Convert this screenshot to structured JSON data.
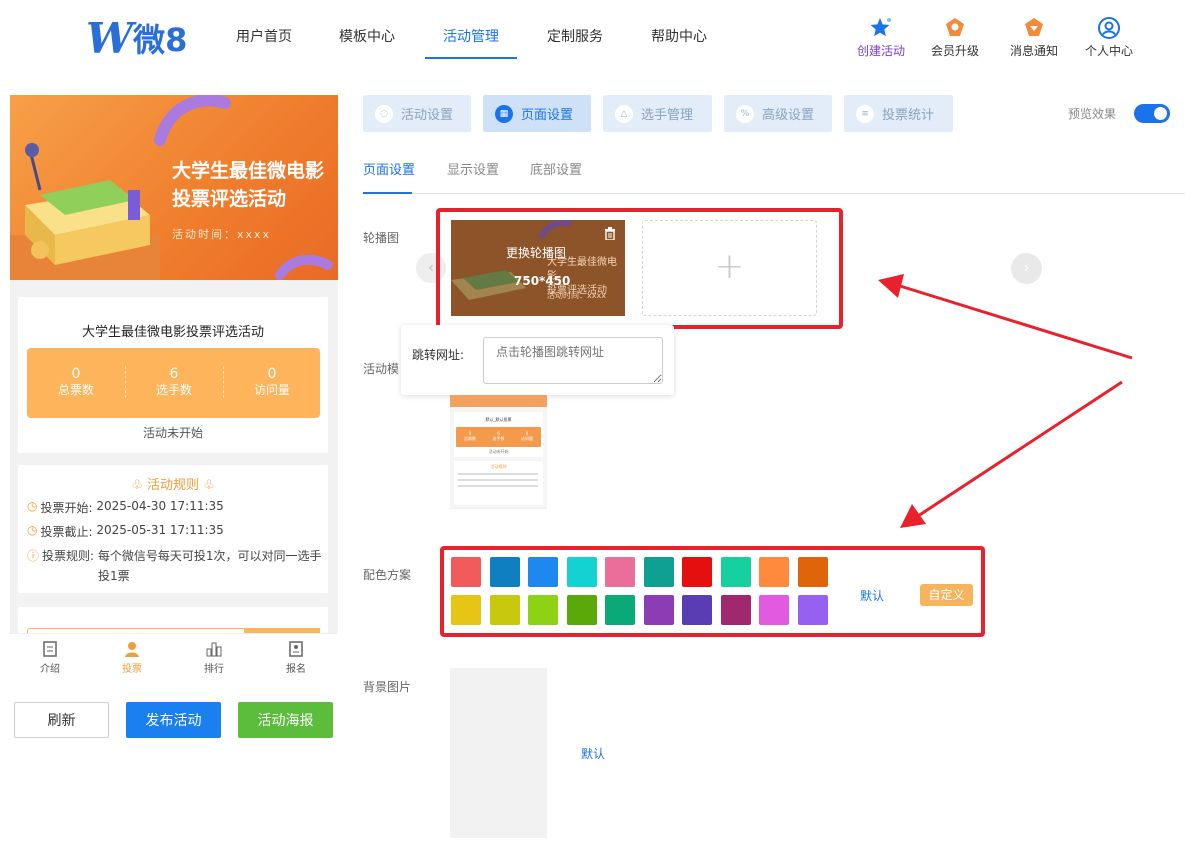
{
  "header": {
    "logo_w": "W",
    "logo_text": "微8",
    "nav": [
      "用户首页",
      "模板中心",
      "活动管理",
      "定制服务",
      "帮助中心"
    ],
    "actions": [
      {
        "label": "创建活动",
        "icon": "star-icon"
      },
      {
        "label": "会员升级",
        "icon": "crown-icon"
      },
      {
        "label": "消息通知",
        "icon": "bell-icon"
      },
      {
        "label": "个人中心",
        "icon": "user-icon"
      }
    ]
  },
  "preview": {
    "banner_title_1": "大学生最佳微电影",
    "banner_title_2": "投票评选活动",
    "banner_time": "活动时间：xxxx",
    "activity_title": "大学生最佳微电影投票评选活动",
    "stats": [
      {
        "num": "0",
        "label": "总票数"
      },
      {
        "num": "6",
        "label": "选手数"
      },
      {
        "num": "0",
        "label": "访问量"
      }
    ],
    "status": "活动未开始",
    "rules_title": "活动规则",
    "rules": [
      {
        "label": "投票开始:",
        "value": "2025-04-30 17:11:35"
      },
      {
        "label": "投票截止:",
        "value": "2025-05-31 17:11:35"
      },
      {
        "label": "投票规则:",
        "value": "每个微信号每天可投1次，可以对同一选手",
        "value2": "投1票"
      }
    ],
    "tabs": [
      "介绍",
      "投票",
      "排行",
      "报名"
    ],
    "buttons": {
      "refresh": "刷新",
      "publish": "发布活动",
      "poster": "活动海报"
    }
  },
  "settings": {
    "top_tabs": [
      "活动设置",
      "页面设置",
      "选手管理",
      "高级设置",
      "投票统计"
    ],
    "preview_label": "预览效果",
    "sub_tabs": [
      "页面设置",
      "显示设置",
      "底部设置"
    ],
    "carousel_label": "轮播图",
    "carousel_overlay": "更换轮播图",
    "carousel_size": "750*450",
    "carousel_thumb_title_1": "大学生最佳微电影",
    "carousel_thumb_title_2": "投票评选活动",
    "carousel_thumb_time": "活动时间：xxxx",
    "add_symbol": "+",
    "link_label": "跳转网址:",
    "link_placeholder": "点击轮播图跳转网址",
    "template_label": "活动模",
    "color_label": "配色方案",
    "color_default": "默认",
    "color_custom": "自定义",
    "bg_label": "背景图片",
    "bg_default": "默认",
    "mini": {
      "title": "默认_默认投票",
      "stats": [
        "0",
        "6",
        "0"
      ],
      "stat_labels": [
        "总票数",
        "选手数",
        "访问量"
      ],
      "status": "活动未开始",
      "rules_title": "活动规则"
    }
  },
  "colors": {
    "row1": [
      "#f25b5b",
      "#0f7fc2",
      "#1e88f0",
      "#14d2d2",
      "#eb6e9a",
      "#0fa092",
      "#e60f0f",
      "#16d0a0",
      "#ff8a3d",
      "#e0650a"
    ],
    "row2": [
      "#e6c514",
      "#c8c80c",
      "#8dd214",
      "#5aa80a",
      "#0aaa78",
      "#8c3cb4",
      "#5a3cb4",
      "#a0286e",
      "#e25ae0",
      "#9660f0"
    ],
    "accent": "#1a73e8",
    "highlight": "#e8212c",
    "orange": "#fdb45a"
  }
}
